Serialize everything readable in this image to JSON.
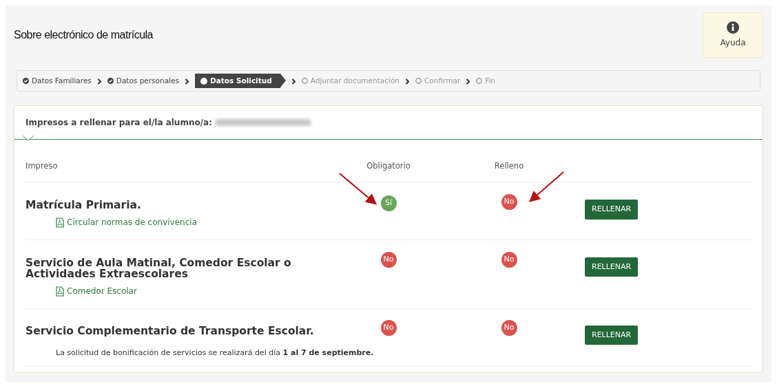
{
  "title": "Sobre electrónico de matrícula",
  "help": {
    "label": "Ayuda"
  },
  "steps": [
    {
      "label": "Datos Familiares",
      "done": true,
      "selected": false
    },
    {
      "label": "Datos personales",
      "done": true,
      "selected": false
    },
    {
      "label": "Datos Solicitud",
      "selected": true
    },
    {
      "label": "Adjuntar documentación",
      "done": false,
      "selected": false
    },
    {
      "label": "Confirmar",
      "done": false,
      "selected": false
    },
    {
      "label": "Fin",
      "done": false,
      "selected": false
    }
  ],
  "card": {
    "heading": "Impresos a rellenar para el/la alumno/a:",
    "columns": [
      "Impreso",
      "Obligatorio",
      "Relleno"
    ],
    "rows": [
      {
        "name": "Matrícula Primaria.",
        "required": {
          "text": "Sí",
          "yes": true
        },
        "filled": {
          "text": "No",
          "yes": false
        },
        "button": "RELLENAR",
        "links": [
          "Circular normas de convivencia"
        ]
      },
      {
        "name": "Servicio de Aula Matinal, Comedor Escolar o Actividades Extraescolares",
        "required": {
          "text": "No",
          "yes": false
        },
        "filled": {
          "text": "No",
          "yes": false
        },
        "button": "RELLENAR",
        "links": [
          "Comedor Escolar"
        ]
      },
      {
        "name": "Servicio Complementario de Transporte Escolar.",
        "required": {
          "text": "No",
          "yes": false
        },
        "filled": {
          "text": "No",
          "yes": false
        },
        "button": "RELLENAR",
        "note": "La solicitud de bonificación de servicios se realizará del día **1 al 7 de septiembre.**"
      }
    ]
  }
}
